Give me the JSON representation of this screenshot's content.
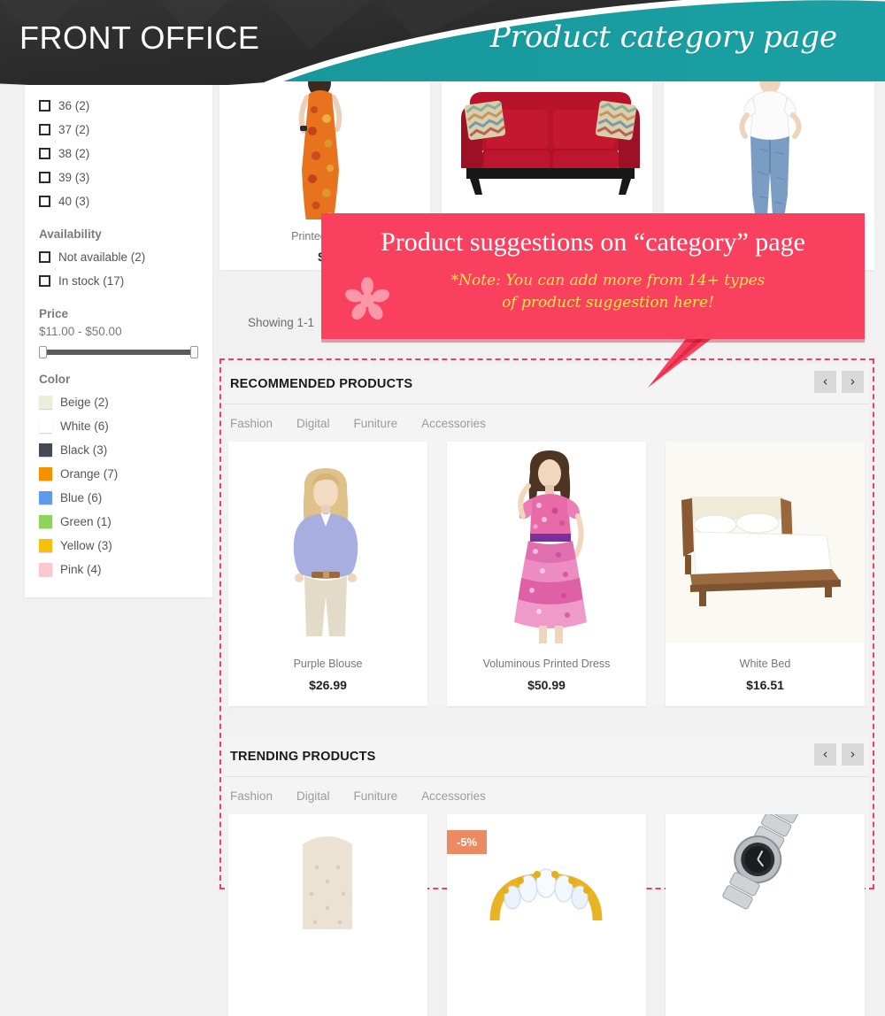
{
  "banner": {
    "left_title": "FRONT OFFICE",
    "right_title": "Product category page",
    "dark_color": "#2e2e2e",
    "teal_color": "#189a9e"
  },
  "sidebar": {
    "sizes": [
      {
        "label": "36 (2)"
      },
      {
        "label": "37 (2)"
      },
      {
        "label": "38 (2)"
      },
      {
        "label": "39 (3)"
      },
      {
        "label": "40 (3)"
      }
    ],
    "availability": {
      "title": "Availability",
      "items": [
        {
          "label": "Not available (2)"
        },
        {
          "label": "In stock (17)"
        }
      ]
    },
    "price": {
      "title": "Price",
      "range": "$11.00 - $50.00"
    },
    "color": {
      "title": "Color",
      "items": [
        {
          "label": "Beige (2)",
          "hex": "#edeed7"
        },
        {
          "label": "White (6)",
          "hex": "#ffffff"
        },
        {
          "label": "Black (3)",
          "hex": "#434a54"
        },
        {
          "label": "Orange (7)",
          "hex": "#f59100"
        },
        {
          "label": "Blue (6)",
          "hex": "#5d9cec"
        },
        {
          "label": "Green (1)",
          "hex": "#8fd35c"
        },
        {
          "label": "Yellow (3)",
          "hex": "#f5c00c"
        },
        {
          "label": "Pink (4)",
          "hex": "#fbc8d1"
        }
      ]
    }
  },
  "catalog": {
    "top_products": [
      {
        "name": "Printed Dress",
        "price": "$2",
        "img": "orange-floral-maxi-dress"
      },
      {
        "name": "",
        "price": "",
        "img": "red-sofa"
      },
      {
        "name": "",
        "price": "",
        "img": "white-top-jeans-model"
      }
    ],
    "showing_text": "Showing 1-1"
  },
  "callout": {
    "heading": "Product suggestions on “category” page",
    "note_line1": "*Note: You can add more from 14+ types",
    "note_line2": "of product suggestion here!",
    "bg_color": "#f9415f",
    "note_color": "#ffe74d"
  },
  "suggestions": [
    {
      "title": "RECOMMENDED PRODUCTS",
      "tabs": [
        "Fashion",
        "Digital",
        "Funiture",
        "Accessories"
      ],
      "prev_label": "‹",
      "next_label": "›",
      "products": [
        {
          "name": "Purple Blouse",
          "price": "$26.99",
          "badge": "",
          "img": "blonde-model-purple-blouse"
        },
        {
          "name": "Voluminous Printed Dress",
          "price": "$50.99",
          "badge": "",
          "img": "model-pink-ruffle-dress"
        },
        {
          "name": "White Bed",
          "price": "$16.51",
          "badge": "",
          "img": "wooden-bed-white-mattress"
        }
      ]
    },
    {
      "title": "TRENDING PRODUCTS",
      "tabs": [
        "Fashion",
        "Digital",
        "Funiture",
        "Accessories"
      ],
      "prev_label": "‹",
      "next_label": "›",
      "products": [
        {
          "name": "",
          "price": "",
          "badge": "",
          "img": "beige-tufted-headboard"
        },
        {
          "name": "",
          "price": "",
          "badge": "-5%",
          "img": "gold-diamond-ring"
        },
        {
          "name": "",
          "price": "",
          "badge": "",
          "img": "silver-wrist-watch"
        }
      ]
    }
  ]
}
